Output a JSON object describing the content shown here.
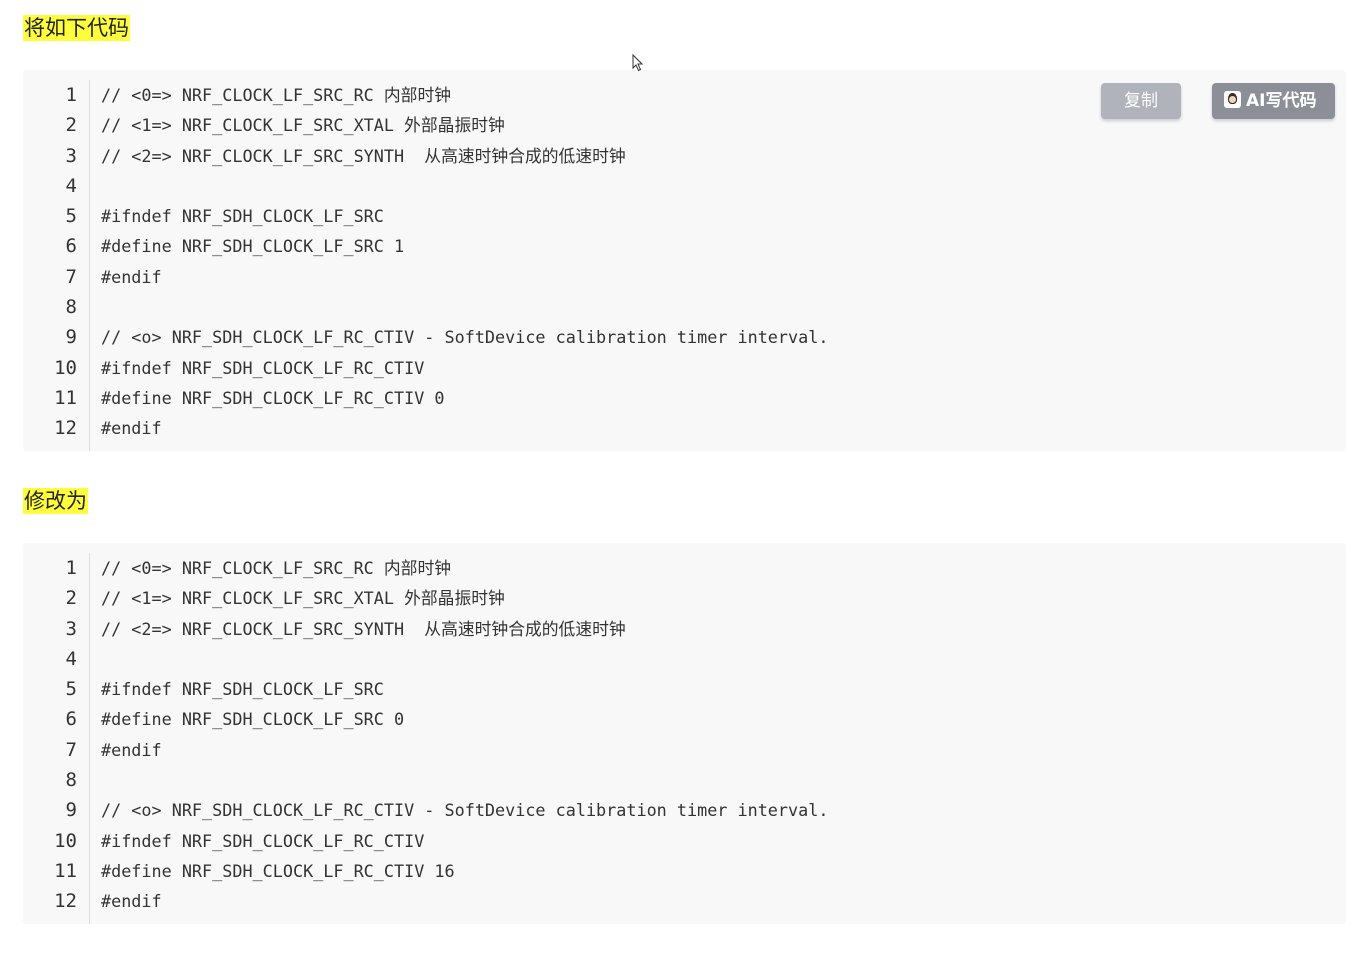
{
  "sections": [
    {
      "heading": "将如下代码",
      "copy_label": "复制",
      "ai_label": "AI写代码",
      "lines": [
        {
          "n": "1",
          "code": "// <0=> NRF_CLOCK_LF_SRC_RC 内部时钟"
        },
        {
          "n": "2",
          "code": "// <1=> NRF_CLOCK_LF_SRC_XTAL 外部晶振时钟"
        },
        {
          "n": "3",
          "code": "// <2=> NRF_CLOCK_LF_SRC_SYNTH  从高速时钟合成的低速时钟"
        },
        {
          "n": "4",
          "code": ""
        },
        {
          "n": "5",
          "code": "#ifndef NRF_SDH_CLOCK_LF_SRC"
        },
        {
          "n": "6",
          "code": "#define NRF_SDH_CLOCK_LF_SRC 1"
        },
        {
          "n": "7",
          "code": "#endif"
        },
        {
          "n": "8",
          "code": ""
        },
        {
          "n": "9",
          "code": "// <o> NRF_SDH_CLOCK_LF_RC_CTIV - SoftDevice calibration timer interval."
        },
        {
          "n": "10",
          "code": "#ifndef NRF_SDH_CLOCK_LF_RC_CTIV"
        },
        {
          "n": "11",
          "code": "#define NRF_SDH_CLOCK_LF_RC_CTIV 0"
        },
        {
          "n": "12",
          "code": "#endif"
        }
      ]
    },
    {
      "heading": "修改为",
      "lines": [
        {
          "n": "1",
          "code": "// <0=> NRF_CLOCK_LF_SRC_RC 内部时钟"
        },
        {
          "n": "2",
          "code": "// <1=> NRF_CLOCK_LF_SRC_XTAL 外部晶振时钟"
        },
        {
          "n": "3",
          "code": "// <2=> NRF_CLOCK_LF_SRC_SYNTH  从高速时钟合成的低速时钟"
        },
        {
          "n": "4",
          "code": ""
        },
        {
          "n": "5",
          "code": "#ifndef NRF_SDH_CLOCK_LF_SRC"
        },
        {
          "n": "6",
          "code": "#define NRF_SDH_CLOCK_LF_SRC 0"
        },
        {
          "n": "7",
          "code": "#endif"
        },
        {
          "n": "8",
          "code": ""
        },
        {
          "n": "9",
          "code": "// <o> NRF_SDH_CLOCK_LF_RC_CTIV - SoftDevice calibration timer interval."
        },
        {
          "n": "10",
          "code": "#ifndef NRF_SDH_CLOCK_LF_RC_CTIV"
        },
        {
          "n": "11",
          "code": "#define NRF_SDH_CLOCK_LF_RC_CTIV 16"
        },
        {
          "n": "12",
          "code": "#endif"
        }
      ]
    }
  ],
  "icons": {
    "ai_avatar": "ai-avatar-icon",
    "cursor": "mouse-cursor-icon"
  },
  "colors": {
    "highlight": "#fefe3c",
    "code_background": "#f8f8f8",
    "copy_button": "#b0b3bb",
    "ai_button": "#8c8f98"
  }
}
